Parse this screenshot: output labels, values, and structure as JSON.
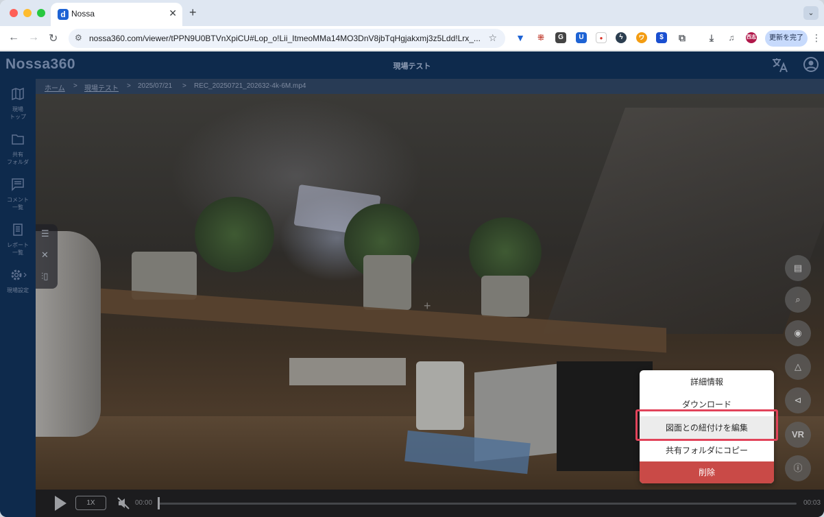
{
  "browser": {
    "tab_title": "Nossa",
    "favicon": "d",
    "url": "nossa360.com/viewer/tPPN9U0BTVnXpiCU#Lop_o!Lii_ItmeoMMa14MO3DnV8jbTqHgjakxmj3z5Ldd!Lrx_...",
    "update_label": "更新を完了",
    "profile_initials": "西志"
  },
  "app": {
    "logo": "Nossa360",
    "title": "現場テスト"
  },
  "sidebar": {
    "items": [
      {
        "label": "現場\nトップ",
        "icon": "map-icon"
      },
      {
        "label": "共有\nフォルダ",
        "icon": "folder-icon"
      },
      {
        "label": "コメント\n一覧",
        "icon": "comment-icon"
      },
      {
        "label": "レポート\n一覧",
        "icon": "report-icon"
      },
      {
        "label": "現場設定",
        "icon": "gear-icon"
      }
    ]
  },
  "breadcrumb": {
    "home": "ホーム",
    "site": "現場テスト",
    "date": "2025/07/21",
    "file": "REC_20250721_202632-4k-6M.mp4"
  },
  "right_tools": [
    "comment-icon",
    "search-comment-icon",
    "eye-icon",
    "pen-icon",
    "megaphone-icon",
    "VR",
    "info-icon"
  ],
  "context_menu": {
    "items": [
      {
        "label": "詳細情報"
      },
      {
        "label": "ダウンロード"
      },
      {
        "label": "図面との紐付けを編集"
      },
      {
        "label": "共有フォルダにコピー"
      },
      {
        "label": "削除"
      }
    ]
  },
  "player": {
    "speed": "1X",
    "current_time": "00:00",
    "duration": "00:03",
    "progress": 0
  },
  "colors": {
    "accent": "#e2435a",
    "delete": "#c94a47",
    "appbar": "#0e2a4c"
  }
}
